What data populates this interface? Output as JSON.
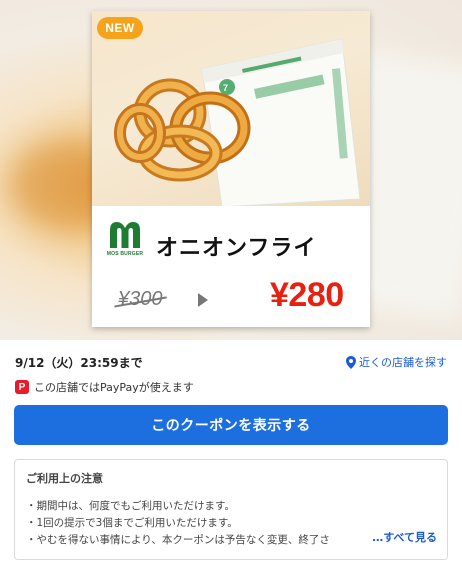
{
  "coupon": {
    "badge": "NEW",
    "product_name": "オニオンフライ",
    "brand_logo_text": "MOS BURGER",
    "old_price": "¥300",
    "new_price": "¥280"
  },
  "info": {
    "expiry": "9/12（火）23:59まで",
    "nearby_label": "近くの店舗を探す",
    "paypay_icon_letter": "P",
    "paypay_text": "この店舗ではPayPayが使えます"
  },
  "actions": {
    "show_coupon_label": "このクーポンを表示する"
  },
  "notice": {
    "title": "ご利用上の注意",
    "items": [
      "期間中は、何度でもご利用いただけます。",
      "1回の提示で3個までご利用いただけます。",
      "やむを得ない事情により、本クーポンは予告なく変更、終了さ"
    ],
    "see_all_label": "…すべて見る"
  },
  "colors": {
    "price_red": "#e8200f",
    "button_blue": "#1d6fe0",
    "link_blue": "#1a5bd6",
    "badge_orange": "#f5a31a",
    "brand_green": "#1e7b32",
    "paypay_red": "#ea1a2a"
  }
}
